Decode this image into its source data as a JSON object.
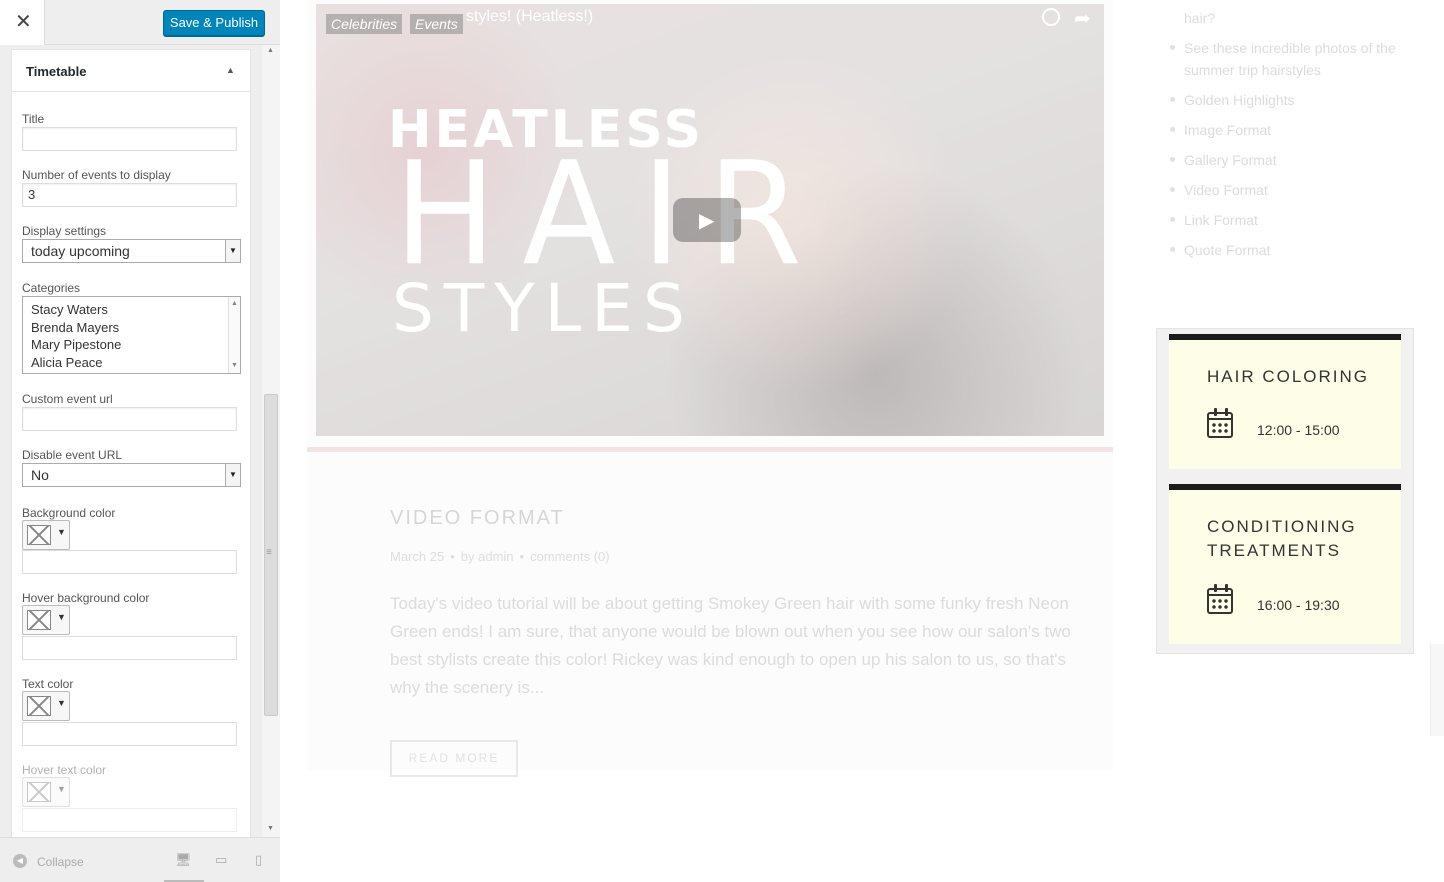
{
  "toolbar": {
    "close_glyph": "✕",
    "publish_label": "Save & Publish"
  },
  "widget": {
    "title": "Timetable",
    "fields": {
      "title_label": "Title",
      "title_value": "",
      "events_label": "Number of events to display",
      "events_value": "3",
      "display_label": "Display settings",
      "display_value": "today upcoming",
      "categories_label": "Categories",
      "categories": [
        "Stacy Waters",
        "Brenda Mayers",
        "Mary Pipestone",
        "Alicia Peace"
      ],
      "custom_url_label": "Custom event url",
      "custom_url_value": "",
      "disable_url_label": "Disable event URL",
      "disable_url_value": "No",
      "bg_color_label": "Background color",
      "hover_bg_color_label": "Hover background color",
      "text_color_label": "Text color",
      "hover_text_color_label": "Hover text color"
    }
  },
  "footer": {
    "collapse_label": "Collapse",
    "devices": [
      "desktop-icon",
      "tablet-icon",
      "mobile-icon"
    ]
  },
  "preview": {
    "video": {
      "title_fragment": "styles! (Heatless!)",
      "tags": [
        "Celebrities",
        "Events"
      ],
      "headline_top": "HEATLESS",
      "headline_mid": "HAIR",
      "headline_bottom": "STYLES"
    },
    "post": {
      "title": "VIDEO FORMAT",
      "date": "March 25",
      "by": "by",
      "author": "admin",
      "comments": "comments (0)",
      "excerpt": "Today's video tutorial will be about getting Smokey Green hair with some funky fresh Neon Green ends! I am sure, that anyone would be blown out when you see how our salon's two best stylists create this color! Rickey was kind enough to open up his salon to us, so that's why the scenery is...",
      "read_more": "READ MORE"
    },
    "recent_links": {
      "partial": "hair?",
      "items": [
        "See these incredible photos of the",
        "summer trip hairstyles",
        "Golden Highlights",
        "Image Format",
        "Gallery Format",
        "Video Format",
        "Link Format",
        "Quote Format"
      ]
    },
    "timetable": [
      {
        "title_line1": "HAIR COLORING",
        "title_line2": "",
        "time": "12:00 - 15:00"
      },
      {
        "title_line1": "CONDITIONING",
        "title_line2": "TREATMENTS",
        "time": "16:00 - 19:30"
      }
    ]
  },
  "colors": {
    "accent": "#0085ba",
    "card_bg": "#fefee8",
    "card_border": "#1b1b1b"
  }
}
